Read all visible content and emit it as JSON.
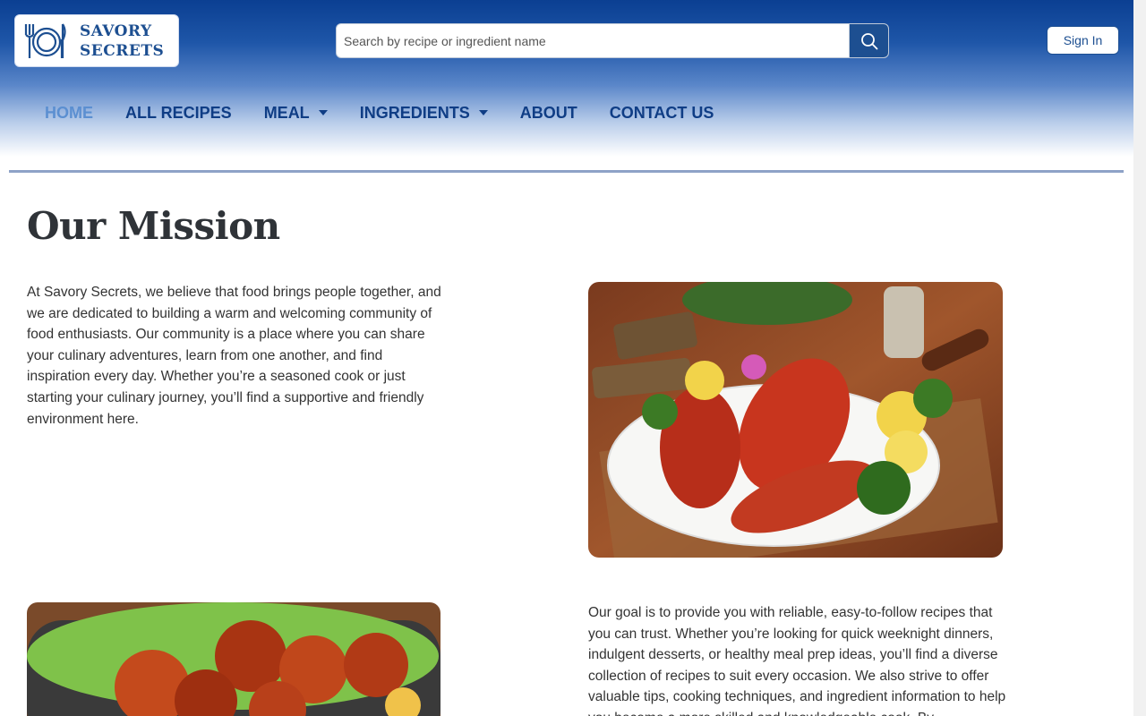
{
  "brand": {
    "line1": "SAVORY",
    "line2": "SECRETS",
    "icon": "plate-fork-knife-icon",
    "color": "#1d4f91"
  },
  "search": {
    "placeholder": "Search by recipe or ingredient name",
    "value": "",
    "icon": "search-icon"
  },
  "auth": {
    "signin_label": "Sign In"
  },
  "nav": {
    "items": [
      {
        "label": "HOME",
        "active": true
      },
      {
        "label": "ALL RECIPES"
      },
      {
        "label": "MEAL",
        "dropdown": true
      },
      {
        "label": "INGREDIENTS",
        "dropdown": true
      },
      {
        "label": "ABOUT"
      },
      {
        "label": "CONTACT US"
      }
    ]
  },
  "main": {
    "title": "Our Mission",
    "paragraph1": "At Savory Secrets, we believe that food brings people together, and we are dedicated to building a warm and welcoming community of food enthusiasts. Our community is a place where you can share your culinary adventures, learn from one another, and find inspiration every day. Whether you’re a seasoned cook or just starting your culinary journey, you’ll find a supportive and friendly environment here.",
    "paragraph2": "Our goal is to provide you with reliable, easy-to-follow recipes that you can trust. Whether you’re looking for quick weeknight dinners, indulgent desserts, or healthy meal prep ideas, you’ll find a diverse collection of recipes to suit every occasion. We also strive to offer valuable tips, cooking techniques, and ingredient information to help you become a more skilled and knowledgeable cook. By"
  },
  "colors": {
    "header_top": "#0b3f92",
    "nav_text": "#0f3d85",
    "nav_active": "#5b8fd1",
    "divider": "#8ea2c7",
    "title": "#2f3338"
  }
}
